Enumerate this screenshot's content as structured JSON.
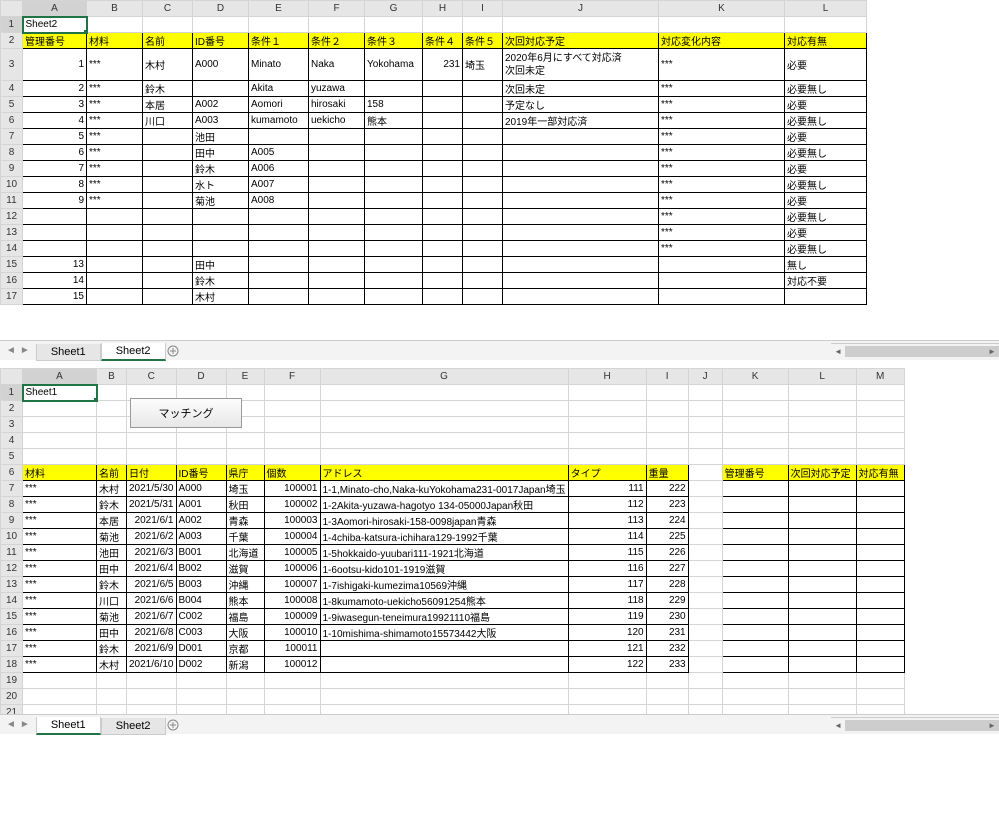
{
  "top": {
    "a1": "Sheet2",
    "cols": [
      "",
      "A",
      "B",
      "C",
      "D",
      "E",
      "F",
      "G",
      "H",
      "I",
      "J",
      "K",
      "L"
    ],
    "row2": [
      "管理番号",
      "材料",
      "名前",
      "ID番号",
      "条件１",
      "条件２",
      "条件３",
      "条件４",
      "条件５",
      "次回対応予定",
      "対応変化内容",
      "対応有無"
    ],
    "rows": [
      {
        "n": 3,
        "c": [
          "1",
          "***",
          "木村",
          "A000",
          "Minato",
          "Naka",
          "Yokohama",
          "231",
          "埼玉",
          "2020年6月にすべて対応済\n次回未定",
          "***",
          "必要"
        ]
      },
      {
        "n": 4,
        "c": [
          "2",
          "***",
          "鈴木",
          "",
          "Akita",
          "yuzawa",
          "",
          "",
          "",
          "次回未定",
          "***",
          "必要無し"
        ]
      },
      {
        "n": 5,
        "c": [
          "3",
          "***",
          "本居",
          "A002",
          "Aomori",
          "hirosaki",
          "158",
          "",
          "",
          "予定なし",
          "***",
          "必要"
        ]
      },
      {
        "n": 6,
        "c": [
          "4",
          "***",
          "川口",
          "A003",
          "kumamoto",
          "uekicho",
          "熊本",
          "",
          "",
          "2019年一部対応済",
          "***",
          "必要無し"
        ]
      },
      {
        "n": 7,
        "c": [
          "5",
          "***",
          "",
          "池田",
          "",
          "",
          "",
          "",
          "",
          "",
          "***",
          "必要"
        ]
      },
      {
        "n": 8,
        "c": [
          "6",
          "***",
          "",
          "田中",
          "A005",
          "",
          "",
          "",
          "",
          "",
          "***",
          "必要無し"
        ]
      },
      {
        "n": 9,
        "c": [
          "7",
          "***",
          "",
          "鈴木",
          "A006",
          "",
          "",
          "",
          "",
          "",
          "***",
          "必要"
        ]
      },
      {
        "n": 10,
        "c": [
          "8",
          "***",
          "",
          "水ト",
          "A007",
          "",
          "",
          "",
          "",
          "",
          "***",
          "必要無し"
        ]
      },
      {
        "n": 11,
        "c": [
          "9",
          "***",
          "",
          "菊池",
          "A008",
          "",
          "",
          "",
          "",
          "",
          "***",
          "必要"
        ]
      },
      {
        "n": 12,
        "c": [
          "",
          "",
          "",
          "",
          "",
          "",
          "",
          "",
          "",
          "",
          "***",
          "必要無し"
        ]
      },
      {
        "n": 13,
        "c": [
          "",
          "",
          "",
          "",
          "",
          "",
          "",
          "",
          "",
          "",
          "***",
          "必要"
        ]
      },
      {
        "n": 14,
        "c": [
          "",
          "",
          "",
          "",
          "",
          "",
          "",
          "",
          "",
          "",
          "***",
          "必要無し"
        ]
      },
      {
        "n": 15,
        "c": [
          "13",
          "",
          "",
          "田中",
          "",
          "",
          "",
          "",
          "",
          "",
          "",
          "無し"
        ]
      },
      {
        "n": 16,
        "c": [
          "14",
          "",
          "",
          "鈴木",
          "",
          "",
          "",
          "",
          "",
          "",
          "",
          "対応不要"
        ]
      },
      {
        "n": 17,
        "c": [
          "15",
          "",
          "",
          "木村",
          "",
          "",
          "",
          "",
          "",
          "",
          "",
          ""
        ]
      }
    ],
    "tabs": [
      "Sheet1",
      "Sheet2"
    ],
    "activeTab": 1
  },
  "bottom": {
    "a1": "Sheet1",
    "button": "マッチング",
    "cols": [
      "",
      "A",
      "B",
      "C",
      "D",
      "E",
      "F",
      "G",
      "H",
      "I",
      "J",
      "K",
      "L",
      "M"
    ],
    "row6_left": [
      "材料",
      "名前",
      "日付",
      "ID番号",
      "県庁",
      "個数",
      "アドレス",
      "タイプ",
      "重量"
    ],
    "row6_right": [
      "管理番号",
      "次回対応予定",
      "対応有無"
    ],
    "rows": [
      {
        "n": 7,
        "c": [
          "***",
          "木村",
          "2021/5/30",
          "A000",
          "埼玉",
          "100001",
          "1-1,Minato-cho,Naka-kuYokohama231-0017Japan埼玉",
          "111",
          "222"
        ]
      },
      {
        "n": 8,
        "c": [
          "***",
          "鈴木",
          "2021/5/31",
          "A001",
          "秋田",
          "100002",
          "1-2Akita-yuzawa-hagotyo 134-05000Japan秋田",
          "112",
          "223"
        ]
      },
      {
        "n": 9,
        "c": [
          "***",
          "本居",
          "2021/6/1",
          "A002",
          "青森",
          "100003",
          "1-3Aomori-hirosaki-158-0098japan青森",
          "113",
          "224"
        ]
      },
      {
        "n": 10,
        "c": [
          "***",
          "菊池",
          "2021/6/2",
          "A003",
          "千葉",
          "100004",
          "1-4chiba-katsura-ichihara129-1992千葉",
          "114",
          "225"
        ]
      },
      {
        "n": 11,
        "c": [
          "***",
          "池田",
          "2021/6/3",
          "B001",
          "北海道",
          "100005",
          "1-5hokkaido-yuubari111-1921北海道",
          "115",
          "226"
        ]
      },
      {
        "n": 12,
        "c": [
          "***",
          "田中",
          "2021/6/4",
          "B002",
          "滋賀",
          "100006",
          "1-6ootsu-kido101-1919滋賀",
          "116",
          "227"
        ]
      },
      {
        "n": 13,
        "c": [
          "***",
          "鈴木",
          "2021/6/5",
          "B003",
          "沖縄",
          "100007",
          "1-7ishigaki-kumezima10569沖縄",
          "117",
          "228"
        ]
      },
      {
        "n": 14,
        "c": [
          "***",
          "川口",
          "2021/6/6",
          "B004",
          "熊本",
          "100008",
          "1-8kumamoto-uekicho56091254熊本",
          "118",
          "229"
        ]
      },
      {
        "n": 15,
        "c": [
          "***",
          "菊池",
          "2021/6/7",
          "C002",
          "福島",
          "100009",
          "1-9iwasegun-teneimura19921110福島",
          "119",
          "230"
        ]
      },
      {
        "n": 16,
        "c": [
          "***",
          "田中",
          "2021/6/8",
          "C003",
          "大阪",
          "100010",
          "1-10mishima-shimamoto15573442大阪",
          "120",
          "231"
        ]
      },
      {
        "n": 17,
        "c": [
          "***",
          "鈴木",
          "2021/6/9",
          "D001",
          "京都",
          "100011",
          "",
          "121",
          "232"
        ]
      },
      {
        "n": 18,
        "c": [
          "***",
          "木村",
          "2021/6/10",
          "D002",
          "新潟",
          "100012",
          "",
          "122",
          "233"
        ]
      }
    ],
    "tabs": [
      "Sheet1",
      "Sheet2"
    ],
    "activeTab": 0
  }
}
